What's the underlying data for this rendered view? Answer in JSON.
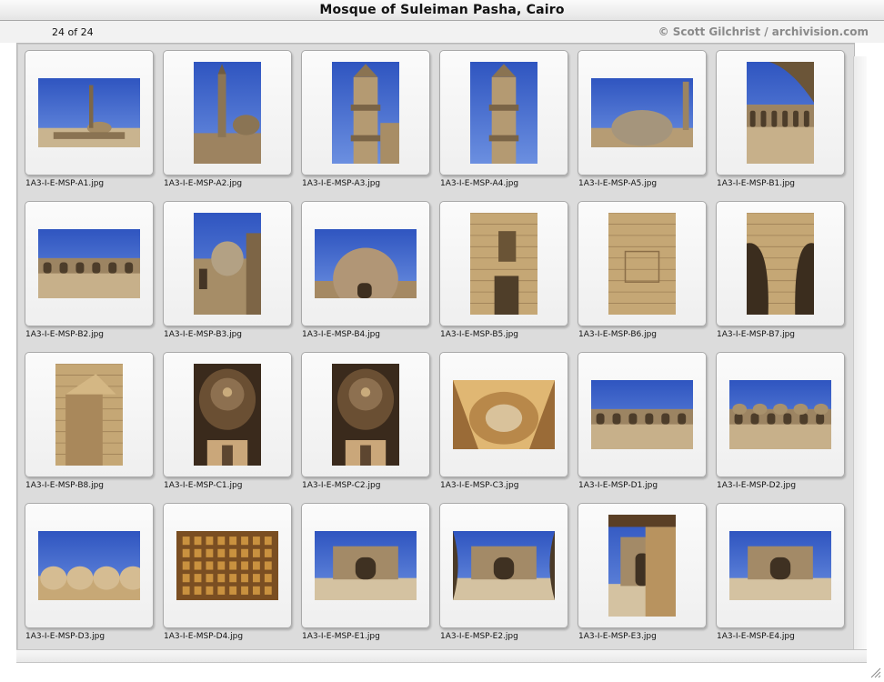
{
  "window": {
    "title": "Mosque of Suleiman Pasha, Cairo"
  },
  "toolbar": {
    "count": "24 of 24",
    "copyright": "© Scott Gilchrist / archivision.com"
  },
  "colors": {
    "sky": "#3b63c9",
    "stone": "#b99a6a",
    "dark_stone": "#6e5637",
    "pane": "#dcdcdc"
  },
  "thumbnails": [
    {
      "file": "1A3-I-E-MSP-A1.jpg",
      "orientation": "landscape",
      "subject": "mosque-minaret-skyline"
    },
    {
      "file": "1A3-I-E-MSP-A2.jpg",
      "orientation": "portrait",
      "subject": "minaret-dome"
    },
    {
      "file": "1A3-I-E-MSP-A3.jpg",
      "orientation": "portrait",
      "subject": "minaret-closeup"
    },
    {
      "file": "1A3-I-E-MSP-A4.jpg",
      "orientation": "portrait",
      "subject": "minaret-top"
    },
    {
      "file": "1A3-I-E-MSP-A5.jpg",
      "orientation": "landscape",
      "subject": "dome"
    },
    {
      "file": "1A3-I-E-MSP-B1.jpg",
      "orientation": "portrait",
      "subject": "courtyard-arch"
    },
    {
      "file": "1A3-I-E-MSP-B2.jpg",
      "orientation": "landscape",
      "subject": "courtyard-arcade"
    },
    {
      "file": "1A3-I-E-MSP-B3.jpg",
      "orientation": "portrait",
      "subject": "dome-arcade"
    },
    {
      "file": "1A3-I-E-MSP-B4.jpg",
      "orientation": "landscape",
      "subject": "large-dome"
    },
    {
      "file": "1A3-I-E-MSP-B5.jpg",
      "orientation": "portrait",
      "subject": "stone-wall-window"
    },
    {
      "file": "1A3-I-E-MSP-B6.jpg",
      "orientation": "portrait",
      "subject": "stone-wall"
    },
    {
      "file": "1A3-I-E-MSP-B7.jpg",
      "orientation": "portrait",
      "subject": "stone-arches"
    },
    {
      "file": "1A3-I-E-MSP-B8.jpg",
      "orientation": "portrait",
      "subject": "column-capital"
    },
    {
      "file": "1A3-I-E-MSP-C1.jpg",
      "orientation": "portrait",
      "subject": "interior-dome"
    },
    {
      "file": "1A3-I-E-MSP-C2.jpg",
      "orientation": "portrait",
      "subject": "interior-dome"
    },
    {
      "file": "1A3-I-E-MSP-C3.jpg",
      "orientation": "landscape",
      "subject": "interior-ceiling"
    },
    {
      "file": "1A3-I-E-MSP-D1.jpg",
      "orientation": "landscape",
      "subject": "courtyard-wide"
    },
    {
      "file": "1A3-I-E-MSP-D2.jpg",
      "orientation": "landscape",
      "subject": "courtyard-domes"
    },
    {
      "file": "1A3-I-E-MSP-D3.jpg",
      "orientation": "landscape",
      "subject": "small-domes"
    },
    {
      "file": "1A3-I-E-MSP-D4.jpg",
      "orientation": "landscape",
      "subject": "wooden-ceiling"
    },
    {
      "file": "1A3-I-E-MSP-E1.jpg",
      "orientation": "landscape",
      "subject": "portal-courtyard"
    },
    {
      "file": "1A3-I-E-MSP-E2.jpg",
      "orientation": "landscape",
      "subject": "portal-fisheye"
    },
    {
      "file": "1A3-I-E-MSP-E3.jpg",
      "orientation": "portrait",
      "subject": "portico"
    },
    {
      "file": "1A3-I-E-MSP-E4.jpg",
      "orientation": "landscape",
      "subject": "portal-facade"
    }
  ]
}
